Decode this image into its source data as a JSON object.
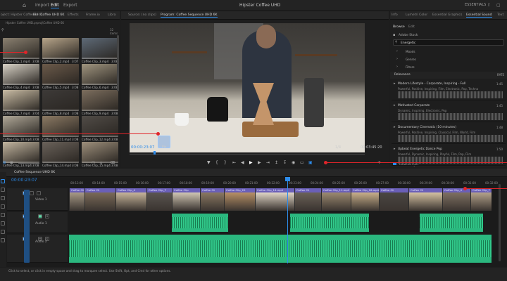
{
  "menu": {
    "home_icon": "home-icon",
    "import": "Import",
    "edit": "Edit",
    "export": "Export",
    "project_title": "Hipster Coffee UHD",
    "workspace": "ESSENTIALS"
  },
  "left_tabs": [
    "oject: Hipster Coffee UHD",
    "Bin: Coffee UHD 6K",
    "Effects",
    "Frame.io",
    "Libra"
  ],
  "bin": {
    "path": "Hipster Coffee UHD.prproj\\Coffee UHD 6K",
    "items_count": "32 items",
    "clips": [
      {
        "name": "Coffee Clip_1.mp4",
        "dur": "3:08"
      },
      {
        "name": "Coffee Clip_2.mp4",
        "dur": "3:07"
      },
      {
        "name": "Coffee Clip_3.mp4",
        "dur": "3:08"
      },
      {
        "name": "Coffee Clip_4.mp4",
        "dur": "3:08"
      },
      {
        "name": "Coffee Clip_5.mp4",
        "dur": "3:08"
      },
      {
        "name": "Coffee Clip_6.mp4",
        "dur": "3:08"
      },
      {
        "name": "Coffee Clip_7.mp4",
        "dur": "3:04"
      },
      {
        "name": "Coffee Clip_8.mp4",
        "dur": "3:08"
      },
      {
        "name": "Coffee Clip_9.mp4",
        "dur": "3:08"
      },
      {
        "name": "Coffee Clip_10.mp4",
        "dur": "3:08"
      },
      {
        "name": "Coffee Clip_11.mp4",
        "dur": "3:08"
      },
      {
        "name": "Coffee Clip_12.mp4",
        "dur": "3:08"
      },
      {
        "name": "Coffee Clip_13.mp4",
        "dur": "3:08"
      },
      {
        "name": "Coffee Clip_14.mp4",
        "dur": "3:08"
      },
      {
        "name": "Coffee Clip_15.mp4",
        "dur": "3:08"
      }
    ]
  },
  "source_tab": "Source: (no clips)",
  "program_tab": "Program: Coffee Sequence UHD 6K",
  "program": {
    "timecode": "00:00:23:07",
    "fit": "Fit",
    "ratio": "1/4",
    "duration": "00:03:45:20"
  },
  "right_tabs": [
    "Info",
    "Lumetri Color",
    "Essential Graphics",
    "Essential Sound",
    "Text"
  ],
  "essential_sound": {
    "browse": "Browse",
    "edit": "Edit",
    "adobe_stock": "Adobe Stock",
    "search_value": "Energetic",
    "filters": [
      "Moods",
      "Genres",
      "Filters"
    ],
    "sort_label": "Relevance",
    "sort_right": "RATE",
    "tracks": [
      {
        "title": "Modern Lifestyle - Corporate, Inspiring - Full",
        "desc": "Powerful, Positive, Inspiring, Film, Electronic, Pop, Techno",
        "dur": "1:45"
      },
      {
        "title": "Motivated Corporate",
        "desc": "Dynamic, Inspiring, Electronic, Pop",
        "dur": "1:45"
      },
      {
        "title": "Documentary Cinematic (10 minutes)",
        "desc": "Powerful, Positive, Inspiring, Classical, Film, World, Film",
        "dur": "1:48"
      },
      {
        "title": "Upbeat Energetic Dance Pop",
        "desc": "Powerful, Dynamic, Inspiring, Playful, Film, Pop, Film",
        "dur": "1:50"
      }
    ],
    "timeline_sync": "Timeline sync"
  },
  "sequence_tab": "Coffee Sequence UHD 6K",
  "timeline": {
    "timecode": "00:00:23:07",
    "ruler": [
      "00:13:00",
      "00:14:00",
      "00:15:00",
      "00:16:00",
      "00:17:00",
      "00:18:00",
      "00:19:00",
      "00:20:00",
      "00:21:00",
      "00:22:00",
      "00:23:00",
      "00:24:00",
      "00:25:00",
      "00:26:00",
      "00:27:00",
      "00:28:00",
      "00:29:00",
      "00:30:00",
      "00:31:00",
      "00:32:00"
    ],
    "video_track": "Video 1",
    "audio1": "Audio 1",
    "audio2": "Audio 2",
    "v1": "V1",
    "a1": "A1",
    "a2": "A2",
    "m": "M",
    "s": "S",
    "clip_names": [
      "Coffee Cli",
      "Coffee Cli",
      "Coffee Clip_4",
      "Coffee Clip_7",
      "Coffee Clip",
      "Coffee Cli",
      "Coffee Clip_20",
      "Coffee Clip_14.mp4",
      "Coffee Cli",
      "Coffee Clip_11.mp4",
      "Coffee Clip_18.mp4"
    ]
  },
  "status": "Click to select, or click in empty space and drag to marquee select. Use Shift, Opt, and Cmd for other options.",
  "colors": {
    "accent": "#2d8ceb",
    "audio": "#2bb87f",
    "video": "#6a5fb8",
    "marker": "#e0252a"
  }
}
